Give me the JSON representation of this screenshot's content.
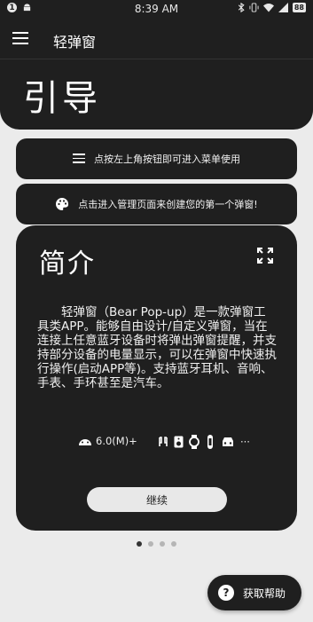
{
  "status_bar": {
    "time": "8:39 AM",
    "notification_badge": "1",
    "battery_level": "88"
  },
  "app_bar": {
    "title": "轻弹窗",
    "menu_icon": "hamburger-icon"
  },
  "page": {
    "title": "引导"
  },
  "tips": [
    {
      "icon": "menu-lines-icon",
      "text": "点按左上角按钮即可进入菜单使用"
    },
    {
      "icon": "palette-icon",
      "text": "点击进入管理页面来创建您的第一个弹窗!"
    }
  ],
  "intro_card": {
    "title": "简介",
    "body": "轻弹窗（Bear Pop-up）是一款弹窗工具类APP。能够自由设计/自定义弹窗，当在连接上任意蓝牙设备时将弹出弹窗提醒，并支持部分设备的电量显示，可以在弹窗中快速执行操作(启动APP等)。支持蓝牙耳机、音响、手表、手环甚至是汽车。",
    "compat_text": "6.0(M)+",
    "devices_more": "···",
    "continue_label": "继续"
  },
  "pager": {
    "total": 4,
    "active_index": 0
  },
  "help": {
    "label": "获取帮助"
  },
  "colors": {
    "background": "#ebebeb",
    "surface": "#1f1f1f",
    "button": "#e8e8e8"
  }
}
